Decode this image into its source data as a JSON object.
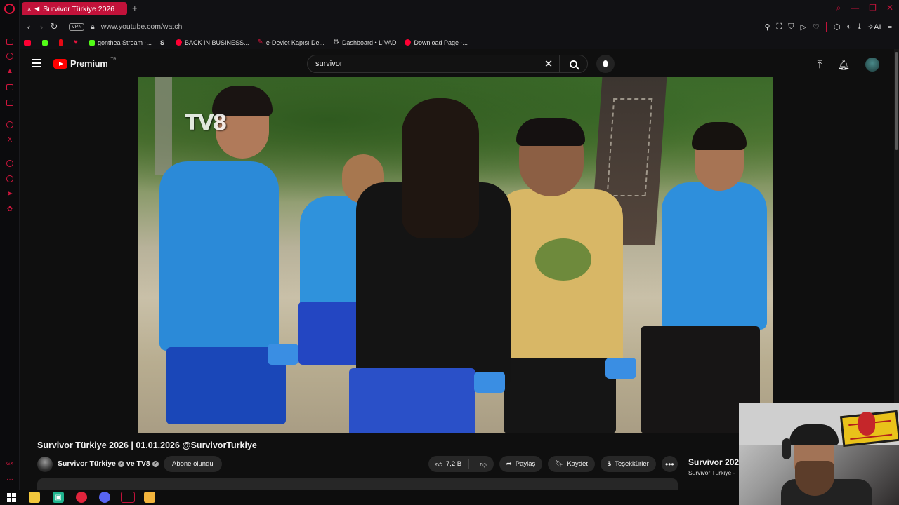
{
  "browser": {
    "tab_title": "Survivor Türkiye 2026",
    "new_tab": "+",
    "vpn_label": "VPN",
    "url": "www.youtube.com/watch",
    "ai_label": "AI",
    "bookmarks": [
      {
        "label": "",
        "icon": "youtube-icon",
        "color": "#ff0033"
      },
      {
        "label": "",
        "icon": "kick-icon",
        "color": "#53fc18"
      },
      {
        "label": "",
        "icon": "netflix-icon",
        "color": "#e50914"
      },
      {
        "label": "",
        "icon": "heart-icon",
        "color": "#e0143c"
      },
      {
        "label": "gonthea Stream -...",
        "icon": "kick-icon",
        "color": "#53fc18"
      },
      {
        "label": "",
        "icon": "s-icon",
        "color": "#ffffff"
      },
      {
        "label": "BACK IN BUSINESS...",
        "icon": "youtube-icon",
        "color": "#ff0033"
      },
      {
        "label": "e-Devlet Kapısı De...",
        "icon": "edevlet-icon",
        "color": "#e0143c"
      },
      {
        "label": "Dashboard • LIVAD",
        "icon": "gear-icon",
        "color": "#cccccc"
      },
      {
        "label": "Download Page -...",
        "icon": "youtube-icon",
        "color": "#ff0033"
      }
    ]
  },
  "youtube": {
    "brand": "Premium",
    "brand_region": "TR",
    "search_value": "survivor",
    "video_title": "Survivor Türkiye 2026 | 01.01.2026 @SurvivorTurkiye",
    "channel_name": "Survivor Türkiye",
    "channel_and": "ve TV8",
    "subscribe_label": "Abone olundu",
    "likes": "7,2 B",
    "share_label": "Paylaş",
    "save_label": "Kaydet",
    "thanks_label": "Teşekkürler",
    "more_label": "•••",
    "tv8_logo": "TV8",
    "side_video": {
      "title": "Survivor 2026",
      "channel": "Survivor Türkiye - "
    }
  },
  "colors": {
    "opera_red": "#c2123a",
    "yt_red": "#ff0000",
    "background": "#0f0f0f"
  }
}
